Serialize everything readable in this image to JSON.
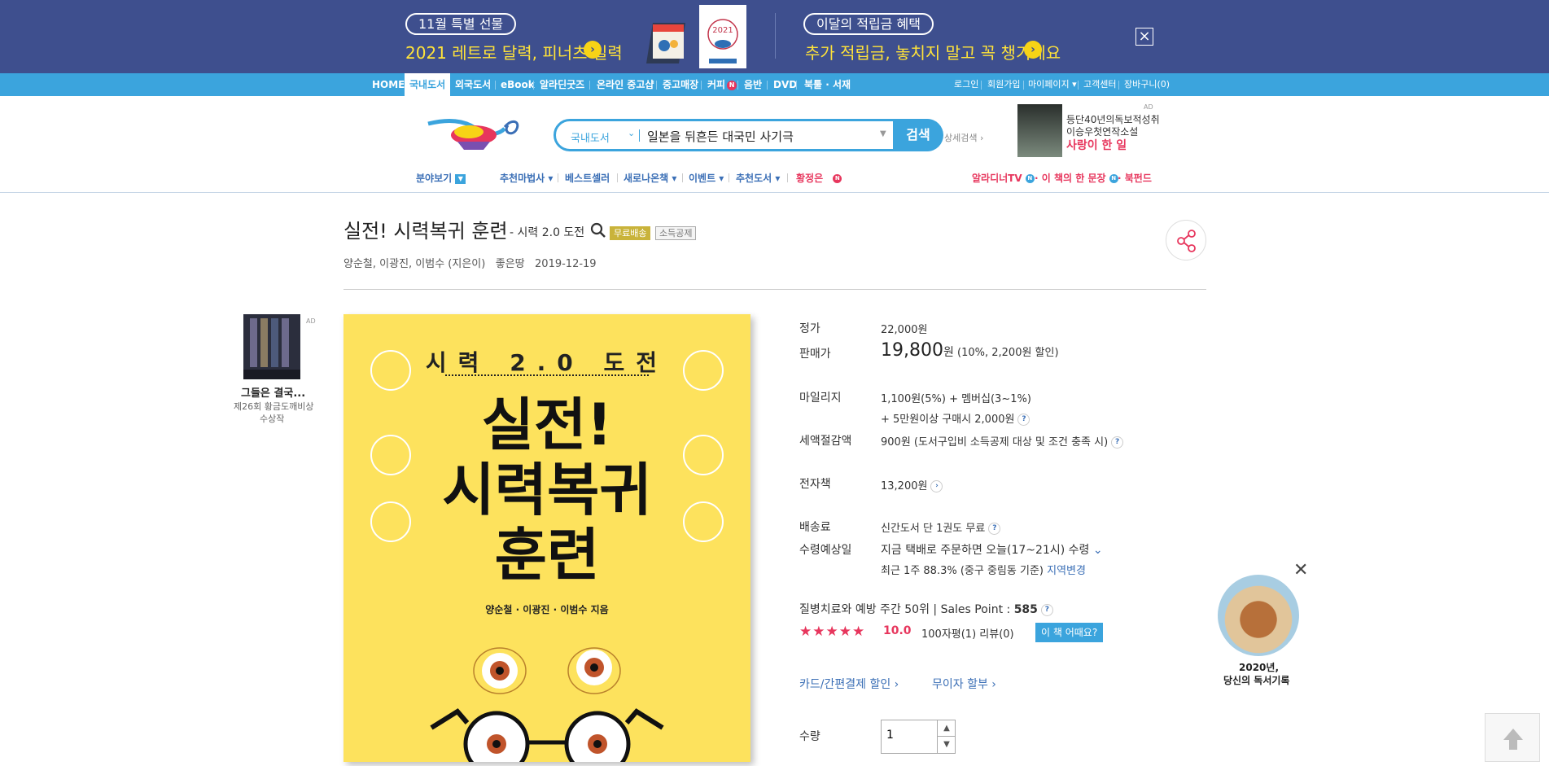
{
  "banner": {
    "left_pill": "11월 특별 선물",
    "left_text": "2021 레트로 달력, 피너츠 일력",
    "calendar_year": "2021",
    "right_pill": "이달의 적립금 혜택",
    "right_text": "추가 적립금, 놓치지 말고 꼭 챙기세요"
  },
  "nav": {
    "items": [
      "HOME",
      "국내도서",
      "외국도서",
      "eBook",
      "알라딘굿즈",
      "온라인 중고샵",
      "중고매장",
      "커피",
      "음반",
      "DVD",
      "북툴 · 서재"
    ],
    "active": "국내도서",
    "badge": "N",
    "right_items": [
      "로그인",
      "회원가입",
      "마이페이지 ▾",
      "고객센터",
      "장바구니(0)"
    ]
  },
  "search": {
    "category": "국내도서",
    "query": "일본을 뒤흔든 대국민 사기극",
    "button": "검색",
    "detail": "상세검색 ›"
  },
  "top_ad": {
    "label": "AD",
    "line1": "등단40년의독보적성취",
    "line2": "이승우첫연작소설",
    "line3": "사랑이 한 일"
  },
  "submenu": {
    "category": "분야보기",
    "items": [
      "추천마법사 ▾",
      "베스트셀러",
      "새로나온책 ▾",
      "이벤트 ▾",
      "추천도서 ▾",
      "황정은"
    ],
    "right_items": [
      "알라디너TV",
      "이 책의 한 문장",
      "북펀드"
    ],
    "badge": "N"
  },
  "book": {
    "title": "실전! 시력복귀 훈련",
    "subtitle": "- 시력 2.0 도전",
    "tag_free": "무료배송",
    "tag_tax": "소득공제",
    "authors": "양순철,   이광진,   이범수 (지은이)",
    "publisher": "좋은땅",
    "date": "2019-12-19"
  },
  "left_ad": {
    "label": "AD",
    "title": "그들은 결국...",
    "sub1": "제26회 황금도깨비상",
    "sub2": "수상작"
  },
  "cover": {
    "top": "시력 2.0 도전",
    "line1": "실전!",
    "line2": "시력복귀",
    "line3": "훈련",
    "authors": "양순철 · 이광진 · 이범수 지음"
  },
  "info": {
    "list_price_label": "정가",
    "list_price": "22,000원",
    "sale_label": "판매가",
    "sale_price": "19,800",
    "sale_unit": "원",
    "sale_discount": "(10%, 2,200원 할인)",
    "mileage_label": "마일리지",
    "mileage1": "1,100원(5%) + 멤버십(3~1%)",
    "mileage2": "+ 5만원이상 구매시 2,000원",
    "tax_label": "세액절감액",
    "tax": "900원 (도서구입비 소득공제 대상 및 조건 충족 시)",
    "ebook_label": "전자책",
    "ebook": "13,200원",
    "ship_label": "배송료",
    "ship": "신간도서 단 1권도 무료",
    "receive_label": "수령예상일",
    "receive": "지금 택배로 주문하면 오늘(17~21시) 수령",
    "recent": "최근 1주 88.3% (중구 중림동 기준)",
    "region_change": "지역변경",
    "rank": "질병치료와 예방 주간 50위  |  Sales Point : ",
    "sales_point": "585",
    "rating": "10.0",
    "stars": "★★★★★",
    "review_count": "100자평(1)   리뷰(0)",
    "review_btn": "이 책 어때요?",
    "card_discount": "카드/간편결제 할인 ›",
    "installment": "무이자 할부 ›",
    "qty_label": "수량",
    "qty": "1"
  },
  "float_panel": {
    "line1": "2020년,",
    "line2": "당신의 독서기록"
  }
}
